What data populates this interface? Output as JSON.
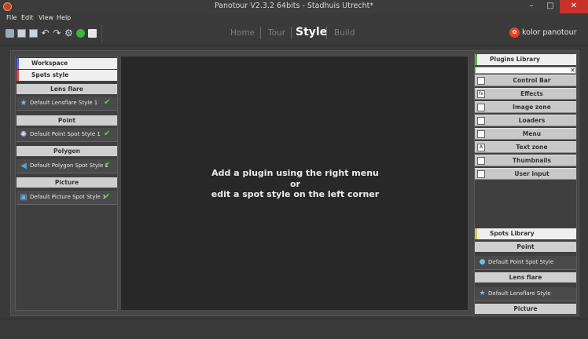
{
  "window": {
    "title": "Panotour V2.3.2 64bits - Stadhuis Utrecht*",
    "app_icon": "panotour-app-icon",
    "controls": {
      "minimize": "–",
      "maximize": "□",
      "close": "✕"
    }
  },
  "menubar": {
    "items": [
      "File",
      "Edit",
      "View",
      "Help"
    ]
  },
  "toolbar": {
    "tools": [
      "database-icon",
      "save-icon",
      "save-as-icon",
      "undo-icon",
      "redo-icon",
      "settings-gear-icon",
      "play-icon",
      "folder-icon"
    ],
    "undo_glyph": "↶",
    "redo_glyph": "↷",
    "gear_glyph": "⚙"
  },
  "nav": {
    "home": "Home",
    "tour": "Tour",
    "style": "Style",
    "build": "Build",
    "active": "Style"
  },
  "brand": {
    "logo_glyph": "✿",
    "name": "kolor panotour",
    "color": "#e2452a"
  },
  "left_panel": {
    "workspace": "Workspace",
    "spots_style": "Spots style",
    "sections": [
      {
        "label": "Lens flare",
        "item": "Default Lensflare Style 1"
      },
      {
        "label": "Point",
        "item": "Default Point Spot Style 1"
      },
      {
        "label": "Polygon",
        "item": "Default Polygon Spot Style 1"
      },
      {
        "label": "Picture",
        "item": "Default Picture Spot Style 1"
      }
    ],
    "check_glyph": "✔",
    "check_color": "#5fd44a"
  },
  "center": {
    "line1": "Add a plugin using the right menu",
    "line2": "or",
    "line3": "edit a spot style on the left corner"
  },
  "plugins_library": {
    "title": "Plugins Library",
    "search_value": "",
    "clear_glyph": "✕",
    "items": [
      {
        "label": "Control Bar",
        "icon": "control-bar-icon",
        "glyph": ""
      },
      {
        "label": "Effects",
        "icon": "effects-icon",
        "glyph": "fx"
      },
      {
        "label": "Image zone",
        "icon": "image-zone-icon",
        "glyph": ""
      },
      {
        "label": "Loaders",
        "icon": "loaders-icon",
        "glyph": ""
      },
      {
        "label": "Menu",
        "icon": "menu-icon",
        "glyph": ""
      },
      {
        "label": "Text zone",
        "icon": "text-zone-icon",
        "glyph": "A"
      },
      {
        "label": "Thumbnails",
        "icon": "thumbnails-icon",
        "glyph": ""
      },
      {
        "label": "User input",
        "icon": "user-input-icon",
        "glyph": ""
      }
    ]
  },
  "spots_library": {
    "title": "Spots Library",
    "sections": [
      {
        "label": "Point",
        "item": "Default Point Spot Style"
      },
      {
        "label": "Lens flare",
        "item": "Default Lensflare Style"
      },
      {
        "label": "Picture",
        "item": ""
      }
    ]
  }
}
